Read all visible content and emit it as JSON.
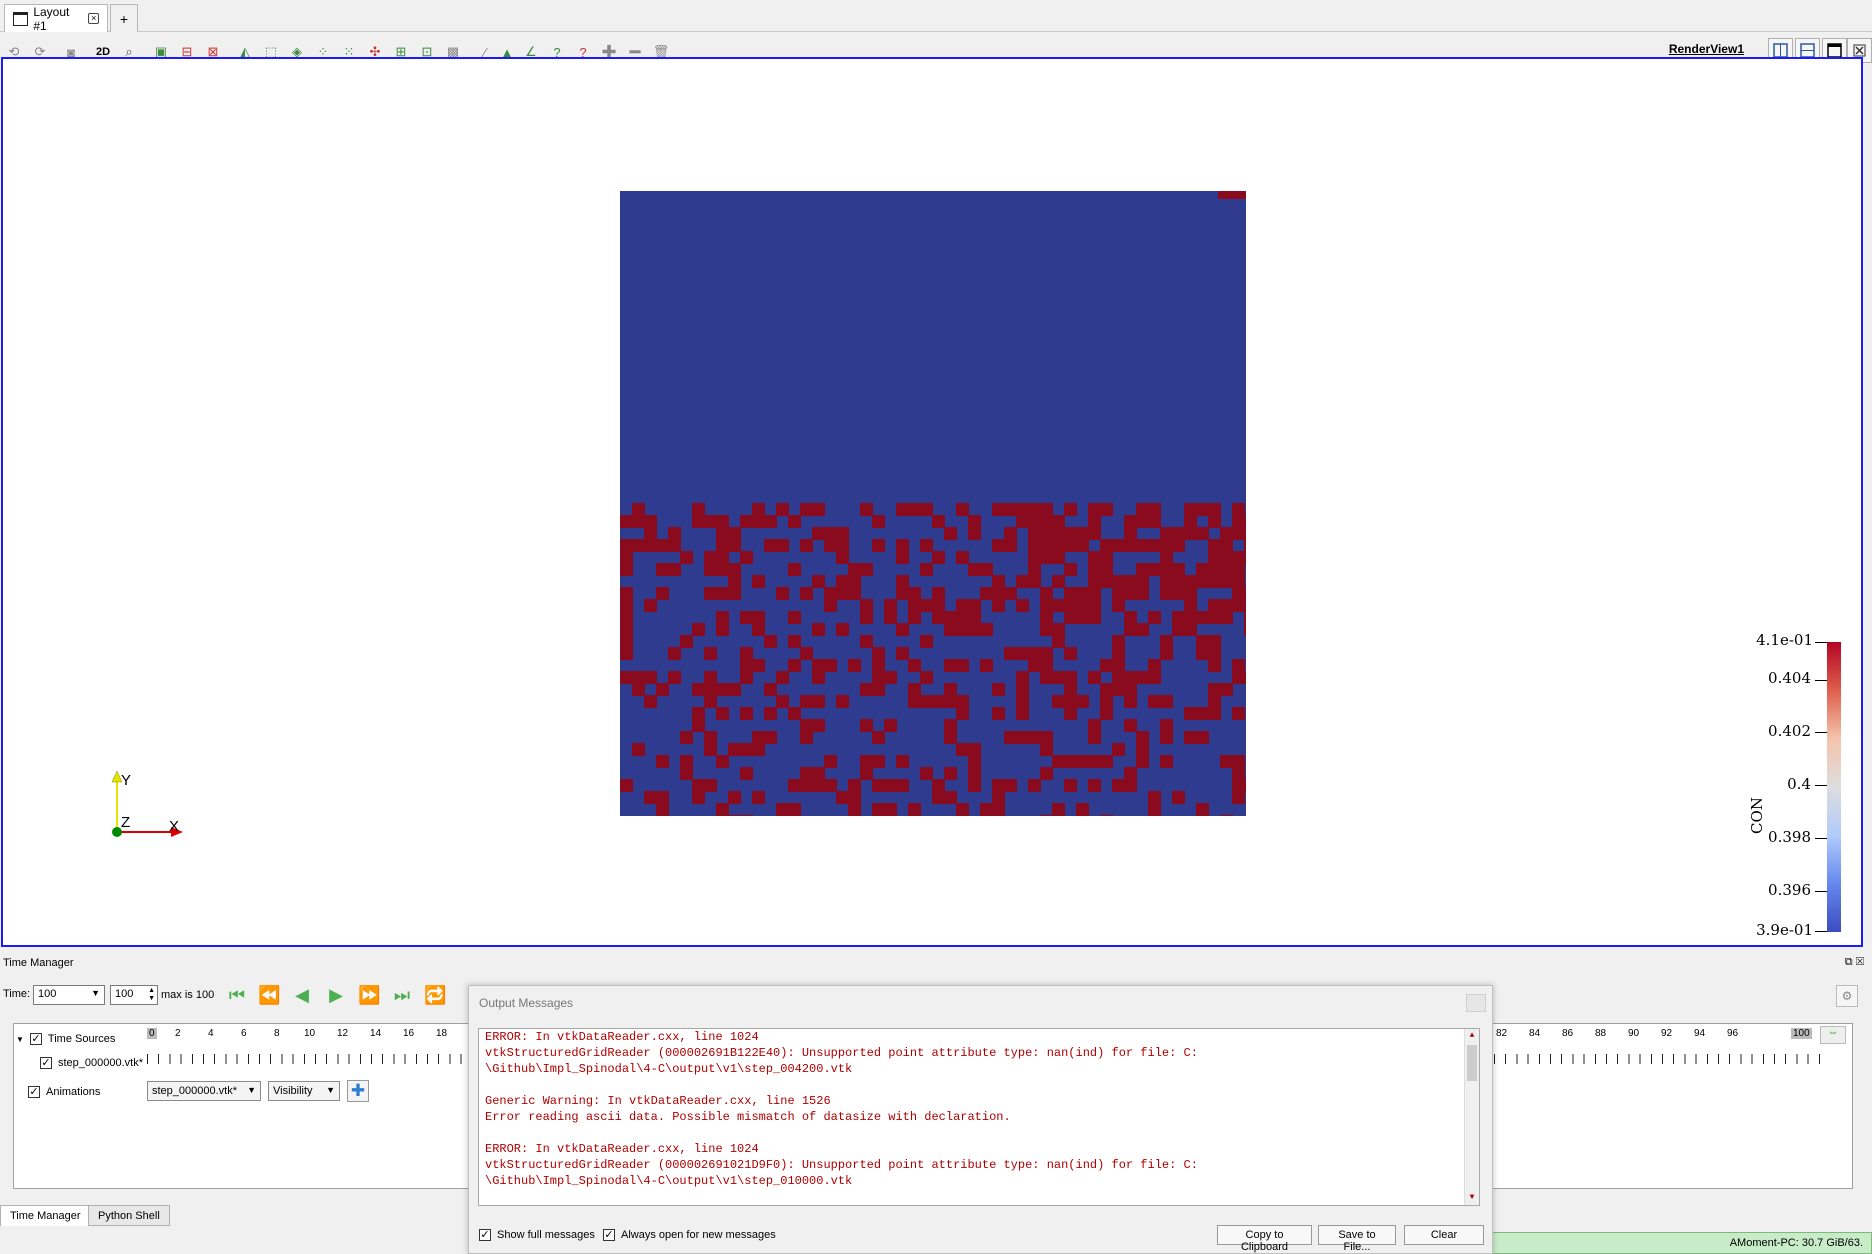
{
  "tabs": {
    "layout_label": "Layout #1",
    "close_glyph": "×",
    "add_label": "+"
  },
  "toolbar": {
    "mode_2d": "2D",
    "renderview_label": "RenderView1",
    "icons": [
      "reset-camera-icon",
      "zoom-to-data-icon",
      "camera-capture-icon",
      "zoom-to-box-icon",
      "select-cells-on-icon",
      "select-points-on-icon",
      "select-cells-through-icon",
      "select-points-through-icon",
      "select-polygon-icon",
      "interactive-select-icon",
      "grow-selection-icon",
      "shrink-selection-icon",
      "clear-selection-icon"
    ]
  },
  "render_view": {
    "axes": {
      "x": "X",
      "y": "Y",
      "z": "Z"
    },
    "colorbar": {
      "title": "CON",
      "max_label": "4.1e-01",
      "min_label": "3.9e-01",
      "ticks": [
        "0.404",
        "0.402",
        "0.4",
        "0.398",
        "0.396"
      ],
      "colors": {
        "high": "#b40426",
        "mid": "#dddddd",
        "low": "#3b4cc0"
      }
    },
    "field_colors": {
      "low": "#2f3b8e",
      "high": "#8a0a1e"
    }
  },
  "time_manager": {
    "title": "Time Manager",
    "time_label": "Time:",
    "time_value": "100",
    "step_value": "100",
    "max_label": "max is 100",
    "time_sources_label": "Time Sources",
    "source_file": "step_000000.vtk*",
    "animations_label": "Animations",
    "anim_source": "step_000000.vtk*",
    "anim_property": "Visibility",
    "ruler_left": [
      "0",
      "2",
      "4",
      "6",
      "8",
      "10",
      "12",
      "14",
      "16",
      "18"
    ],
    "ruler_right": [
      "82",
      "84",
      "86",
      "88",
      "90",
      "92",
      "94",
      "96",
      "100"
    ]
  },
  "bottom_tabs": {
    "time_manager": "Time Manager",
    "python_shell": "Python Shell"
  },
  "status": {
    "memory": "AMoment-PC: 30.7 GiB/63."
  },
  "output_messages": {
    "title": "Output Messages",
    "text": "ERROR: In vtkDataReader.cxx, line 1024\nvtkStructuredGridReader (000002691B122E40): Unsupported point attribute type: nan(ind) for file: C:\n\\Github\\Impl_Spinodal\\4-C\\output\\v1\\step_004200.vtk\n\nGeneric Warning: In vtkDataReader.cxx, line 1526\nError reading ascii data. Possible mismatch of datasize with declaration.\n\nERROR: In vtkDataReader.cxx, line 1024\nvtkStructuredGridReader (000002691021D9F0): Unsupported point attribute type: nan(ind) for file: C:\n\\Github\\Impl_Spinodal\\4-C\\output\\v1\\step_010000.vtk",
    "show_full": "Show full messages",
    "always_open": "Always open for new messages",
    "copy_btn": "Copy to Clipboard",
    "save_btn": "Save to File...",
    "clear_btn": "Clear"
  }
}
